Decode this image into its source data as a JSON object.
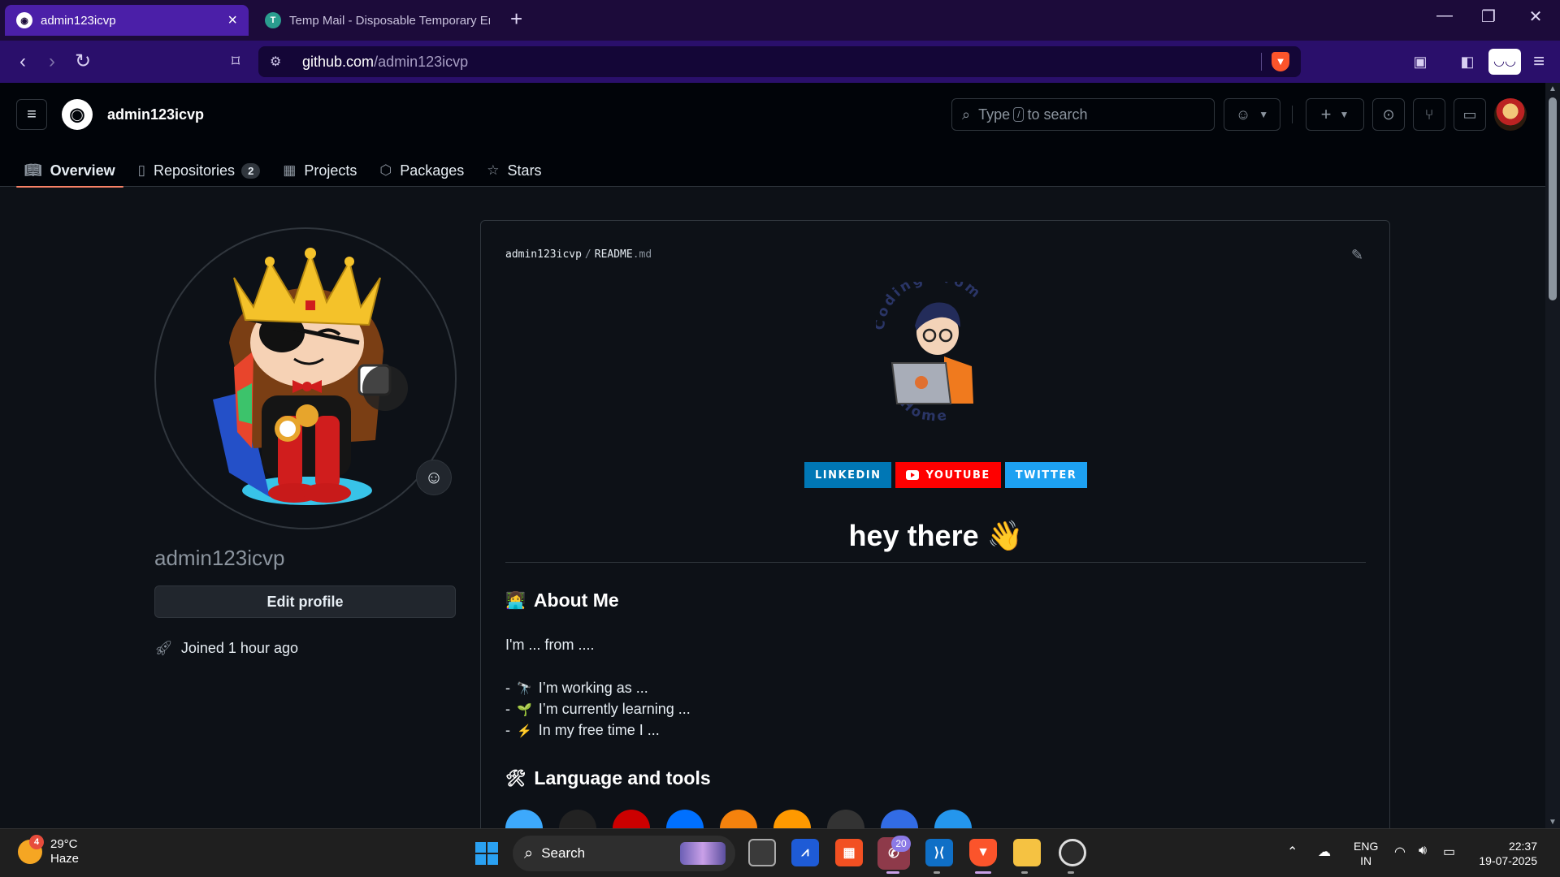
{
  "browser": {
    "tabs": [
      {
        "title": "admin123icvp",
        "favicon": "github-icon"
      },
      {
        "title": "Temp Mail - Disposable Temporary Email",
        "favicon": "tempmail-icon"
      }
    ],
    "new_tab": "+",
    "url_host": "github.com",
    "url_path": "/admin123icvp"
  },
  "header": {
    "username": "admin123icvp",
    "search_prefix": "Type",
    "search_key": "/",
    "search_suffix": "to search",
    "tabs": [
      {
        "label": "Overview",
        "icon": "book-icon"
      },
      {
        "label": "Repositories",
        "icon": "repo-icon",
        "count": "2"
      },
      {
        "label": "Projects",
        "icon": "table-icon"
      },
      {
        "label": "Packages",
        "icon": "package-icon"
      },
      {
        "label": "Stars",
        "icon": "star-icon"
      }
    ]
  },
  "profile": {
    "name": "admin123icvp",
    "edit_label": "Edit profile",
    "joined": "Joined 1 hour ago"
  },
  "readme": {
    "owner": "admin123icvp",
    "file": "README",
    "ext": ".md",
    "illustration_text_top": "Coding From",
    "illustration_text_bottom": "Home",
    "badges": [
      "LINKEDIN",
      "YOUTUBE",
      "TWITTER"
    ],
    "greeting": "hey there",
    "greeting_emoji": "👋",
    "about_title": "About Me",
    "about_intro": "I'm ... from ....",
    "about_items": [
      {
        "prefix": "-",
        "emoji": "🔭",
        "text": "I’m working as ..."
      },
      {
        "prefix": "-",
        "emoji": "🌱",
        "text": "I’m currently learning ..."
      },
      {
        "prefix": "-",
        "emoji": "⚡",
        "text": "In my free time I ..."
      }
    ],
    "tools_title": "Language and tools",
    "tool_colors": [
      "#3da9fc",
      "#222222",
      "#cc0000",
      "#0070ff",
      "#f5820d",
      "#ff9900",
      "#333333",
      "#326ce5",
      "#2496ed"
    ]
  },
  "taskbar": {
    "weather_temp": "29°C",
    "weather_desc": "Haze",
    "weather_badge": "4",
    "search_label": "Search",
    "whatsapp_badge": "20",
    "lang_top": "ENG",
    "lang_bottom": "IN",
    "time": "22:37",
    "date": "19-07-2025"
  },
  "colors": {
    "accent": "#f78166",
    "bg": "#0d1117",
    "header_bg": "#010409",
    "border": "#30363d",
    "browser_tab": "#4b1fa8",
    "browser_nav": "#2a0f6b"
  }
}
